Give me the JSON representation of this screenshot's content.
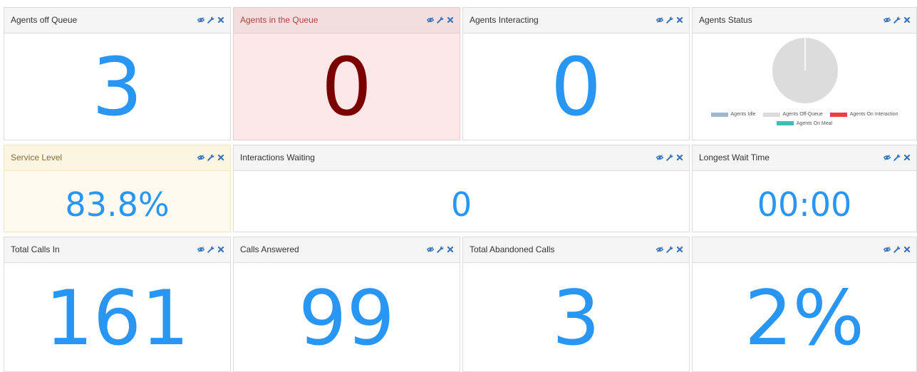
{
  "colors": {
    "value_blue": "#2a96f3",
    "value_danger": "#7b0000",
    "tool_icon": "#3a74b8",
    "agents_idle": "#9cb8d4",
    "agents_off_queue": "#dcdcdc",
    "agents_on_interaction": "#ef3c48",
    "agents_on_meal": "#3cc0b4"
  },
  "tools": {
    "icons": [
      "eye-icon",
      "wrench-icon",
      "close-icon"
    ]
  },
  "panels": {
    "agents_off_queue": {
      "title": "Agents off Queue",
      "value": "3"
    },
    "agents_in_queue": {
      "title": "Agents in the Queue",
      "value": "0"
    },
    "agents_interacting": {
      "title": "Agents Interacting",
      "value": "0"
    },
    "agents_status": {
      "title": "Agents Status",
      "legend": [
        "Agents Idle",
        "Agents Off-Queue",
        "Agents On Interaction",
        "Agents On Meal"
      ]
    },
    "service_level": {
      "title": "Service Level",
      "value": "83.8%"
    },
    "interactions_waiting": {
      "title": "Interactions Waiting",
      "value": "0"
    },
    "longest_wait_time": {
      "title": "Longest Wait Time",
      "value": "00:00"
    },
    "total_calls_in": {
      "title": "Total Calls In",
      "value": "161"
    },
    "calls_answered": {
      "title": "Calls Answered",
      "value": "99"
    },
    "total_abandoned_calls": {
      "title": "Total Abandoned Calls",
      "value": "3"
    },
    "untitled": {
      "title": "",
      "value": "2%"
    }
  },
  "chart_data": {
    "type": "pie",
    "title": "Agents Status",
    "categories": [
      "Agents Idle",
      "Agents Off-Queue",
      "Agents On Interaction",
      "Agents On Meal"
    ],
    "values": [
      0,
      3,
      0,
      0
    ],
    "legend_position": "bottom"
  }
}
